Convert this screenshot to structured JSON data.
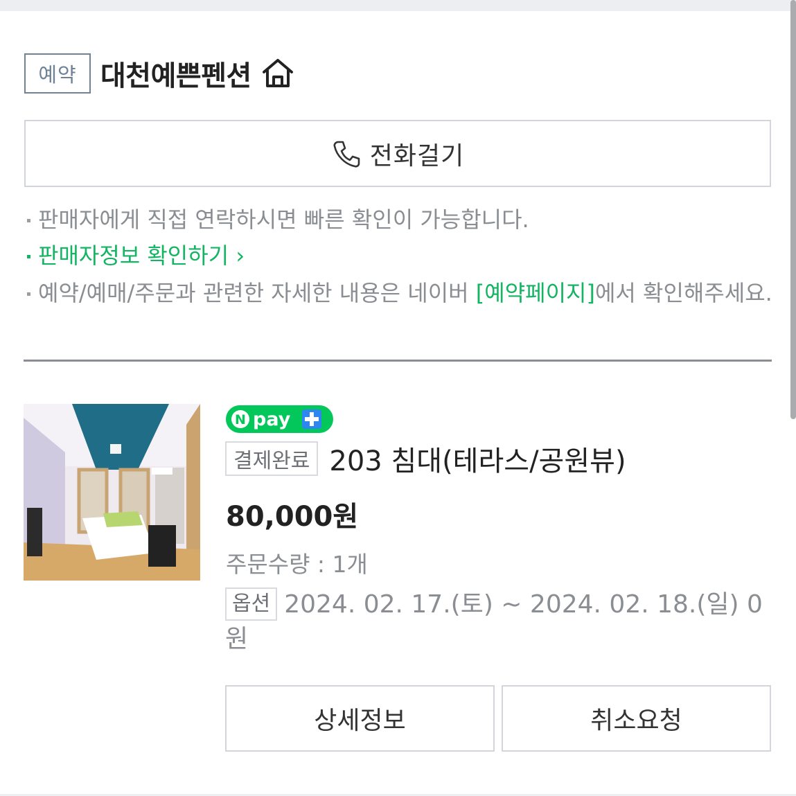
{
  "header": {
    "badge": "예약",
    "shop_name": "대천예쁜펜션"
  },
  "call_button": {
    "label": "전화걸기"
  },
  "notes": {
    "line1": "판매자에게 직접 연락하시면 빠른 확인이 가능합니다.",
    "seller_info_link": "판매자정보 확인하기",
    "line3_prefix": "예약/예매/주문과 관련한 자세한 내용은 네이버 ",
    "line3_link": "[예약페이지]",
    "line3_suffix": "에서 확인해주세요."
  },
  "order": {
    "npay_label": "pay",
    "status": "결제완료",
    "room_title": "203 침대(테라스/공원뷰)",
    "price": "80,000원",
    "quantity": "주문수량 : 1개",
    "option_badge": "옵션",
    "option_text": "2024. 02. 17.(토) ~ 2024. 02. 18.(일) 0원"
  },
  "actions": {
    "detail_label": "상세정보",
    "cancel_label": "취소요청"
  },
  "colors": {
    "accent_green": "#13b462",
    "npay_green": "#03c75a",
    "plus_blue": "#2e86f0",
    "badge_gray_blue": "#6f8295"
  }
}
